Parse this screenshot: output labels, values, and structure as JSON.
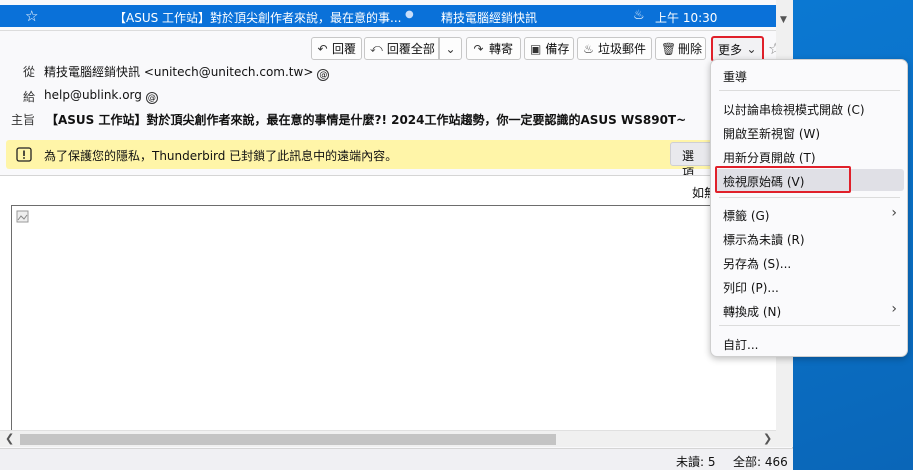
{
  "message_list": {
    "subject": "【ASUS 工作站】對於頂尖創作者來說，最在意的事...",
    "sender": "精技電腦經銷快訊",
    "date": "上午 10:30"
  },
  "toolbar": {
    "reply": "回覆",
    "reply_all": "回覆全部",
    "forward": "轉寄",
    "archive": "備存",
    "junk": "垃圾郵件",
    "delete": "刪除",
    "more": "更多"
  },
  "header": {
    "from_label": "從",
    "from_value": "精技電腦經銷快訊 <unitech@unitech.com.tw>",
    "to_label": "給",
    "to_value": "help@ublink.org",
    "subject_label": "主旨",
    "subject_value": "【ASUS 工作站】對於頂尖創作者來說，最在意的事情是什麼?! 2024工作站趨勢，你一定要認識的ASUS WS890T~"
  },
  "notice": {
    "text": "為了保護您的隱私，Thunderbird 已封鎖了此訊息中的遠端內容。",
    "options_button": "選項"
  },
  "body": {
    "partial_text": "如無"
  },
  "menu": {
    "items": [
      {
        "label": "重導"
      },
      {
        "label": "以討論串檢視模式開啟 (C)"
      },
      {
        "label": "開啟至新視窗 (W)"
      },
      {
        "label": "用新分頁開啟 (T)"
      },
      {
        "label": "檢視原始碼 (V)"
      },
      {
        "label": "標籤 (G)"
      },
      {
        "label": "標示為未讀 (R)"
      },
      {
        "label": "另存為 (S)..."
      },
      {
        "label": "列印 (P)..."
      },
      {
        "label": "轉換成 (N)"
      },
      {
        "label": "自訂..."
      }
    ]
  },
  "status": {
    "unread": "未讀: 5",
    "total": "全部: 466"
  }
}
